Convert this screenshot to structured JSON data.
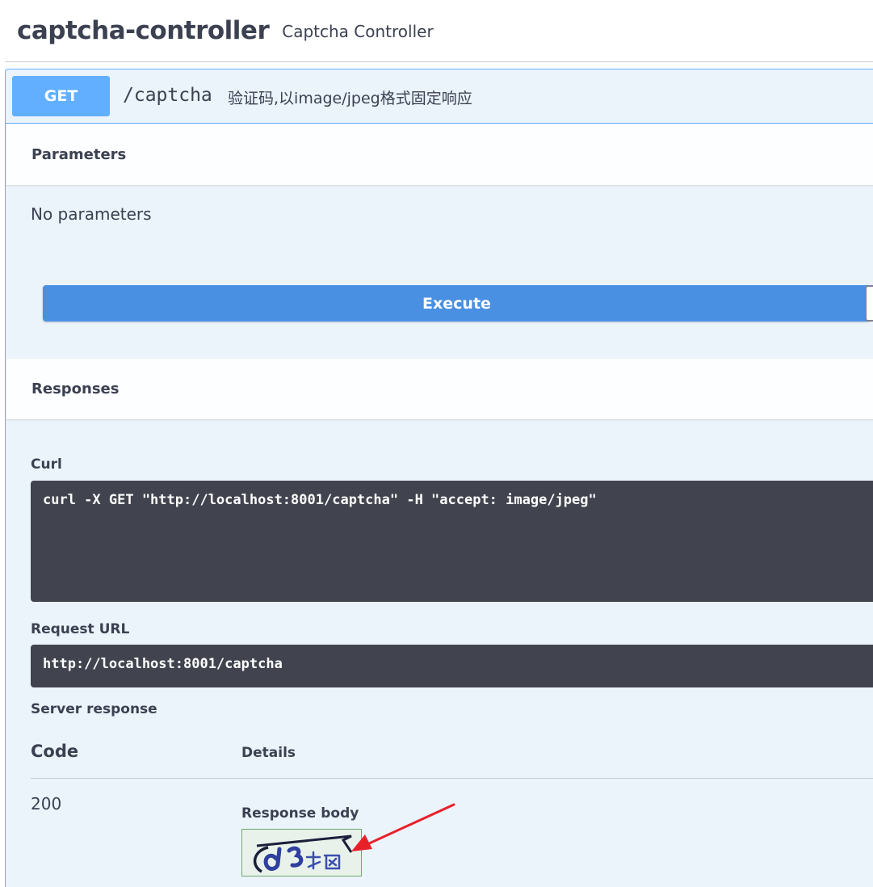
{
  "tag": {
    "title": "captcha-controller",
    "description": "Captcha Controller"
  },
  "operation": {
    "method": "GET",
    "path": "/captcha",
    "summary": "验证码,以image/jpeg格式固定响应"
  },
  "parameters": {
    "header": "Parameters",
    "empty_text": "No parameters"
  },
  "execute_label": "Execute",
  "responses": {
    "header": "Responses",
    "curl_label": "Curl",
    "curl_command": "curl -X GET \"http://localhost:8001/captcha\" -H \"accept: image/jpeg\"",
    "request_url_label": "Request URL",
    "request_url": "http://localhost:8001/captcha",
    "server_response_label": "Server response",
    "code_header": "Code",
    "details_header": "Details",
    "code": "200",
    "response_body_label": "Response body"
  },
  "colors": {
    "get_method": "#61affe",
    "execute_button": "#4990e2",
    "code_background": "#41444e",
    "opblock_background": "#ebf3fb",
    "annotation_arrow": "#e8202a"
  }
}
